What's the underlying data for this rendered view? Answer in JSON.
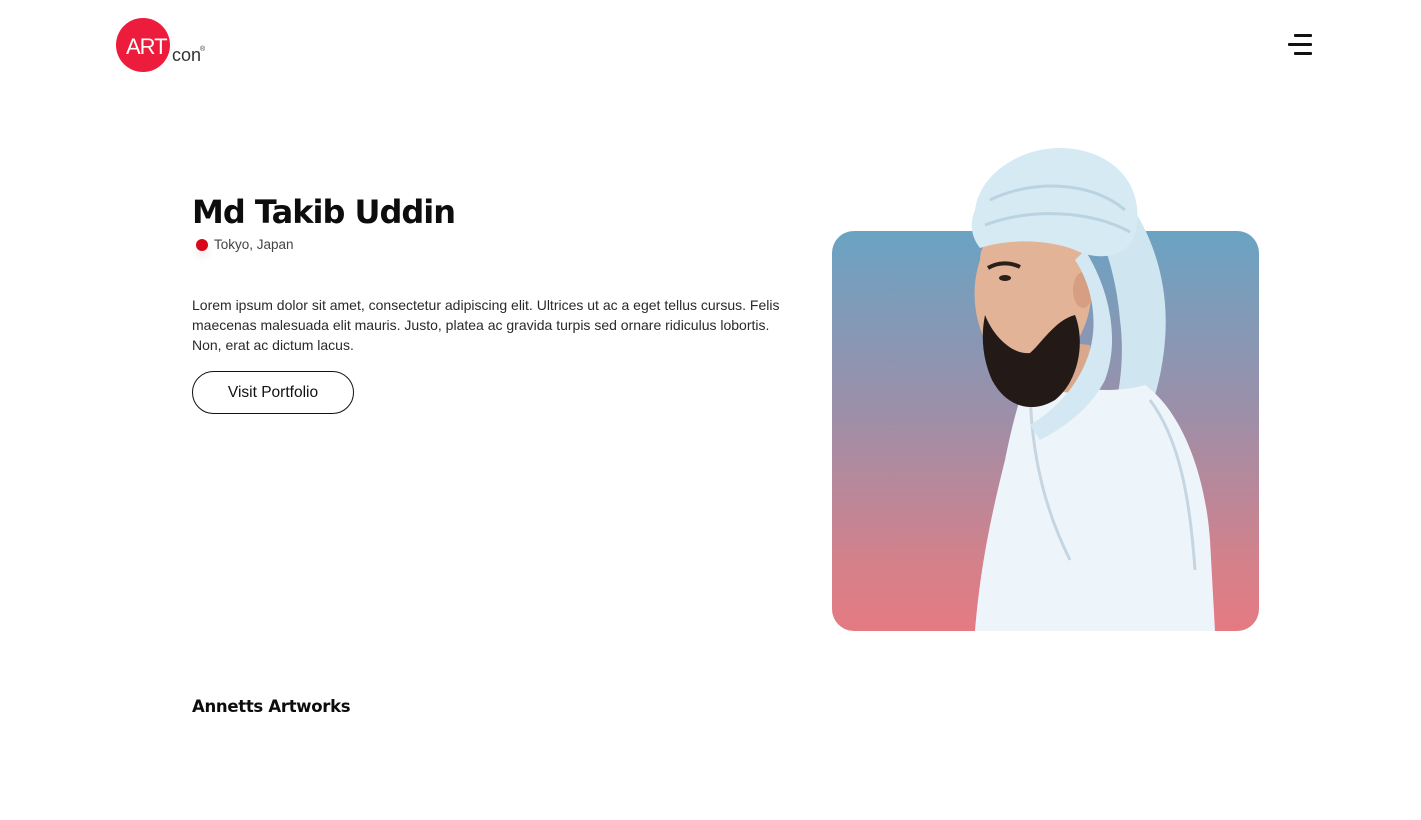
{
  "brand": {
    "logo_primary": "ART",
    "logo_secondary": "con",
    "logo_mark": "®",
    "accent_color": "#ee1c3c"
  },
  "header": {
    "menu_icon": "hamburger-menu-icon"
  },
  "profile": {
    "name": "Md Takib Uddin",
    "location": "Tokyo, Japan",
    "location_icon": "location-dot-icon",
    "bio": "Lorem ipsum dolor sit amet, consectetur adipiscing elit. Ultrices ut ac a eget tellus cursus. Felis maecenas malesuada elit mauris. Justo, platea ac gravida turpis sed ornare ridiculus lobortis. Non, erat ac dictum lacus.",
    "cta_label": "Visit Portfolio",
    "portrait_gradient": [
      "#6aa3c3",
      "#9c8fa9",
      "#e47a82"
    ]
  },
  "artworks": {
    "title": "Annetts Artworks"
  }
}
